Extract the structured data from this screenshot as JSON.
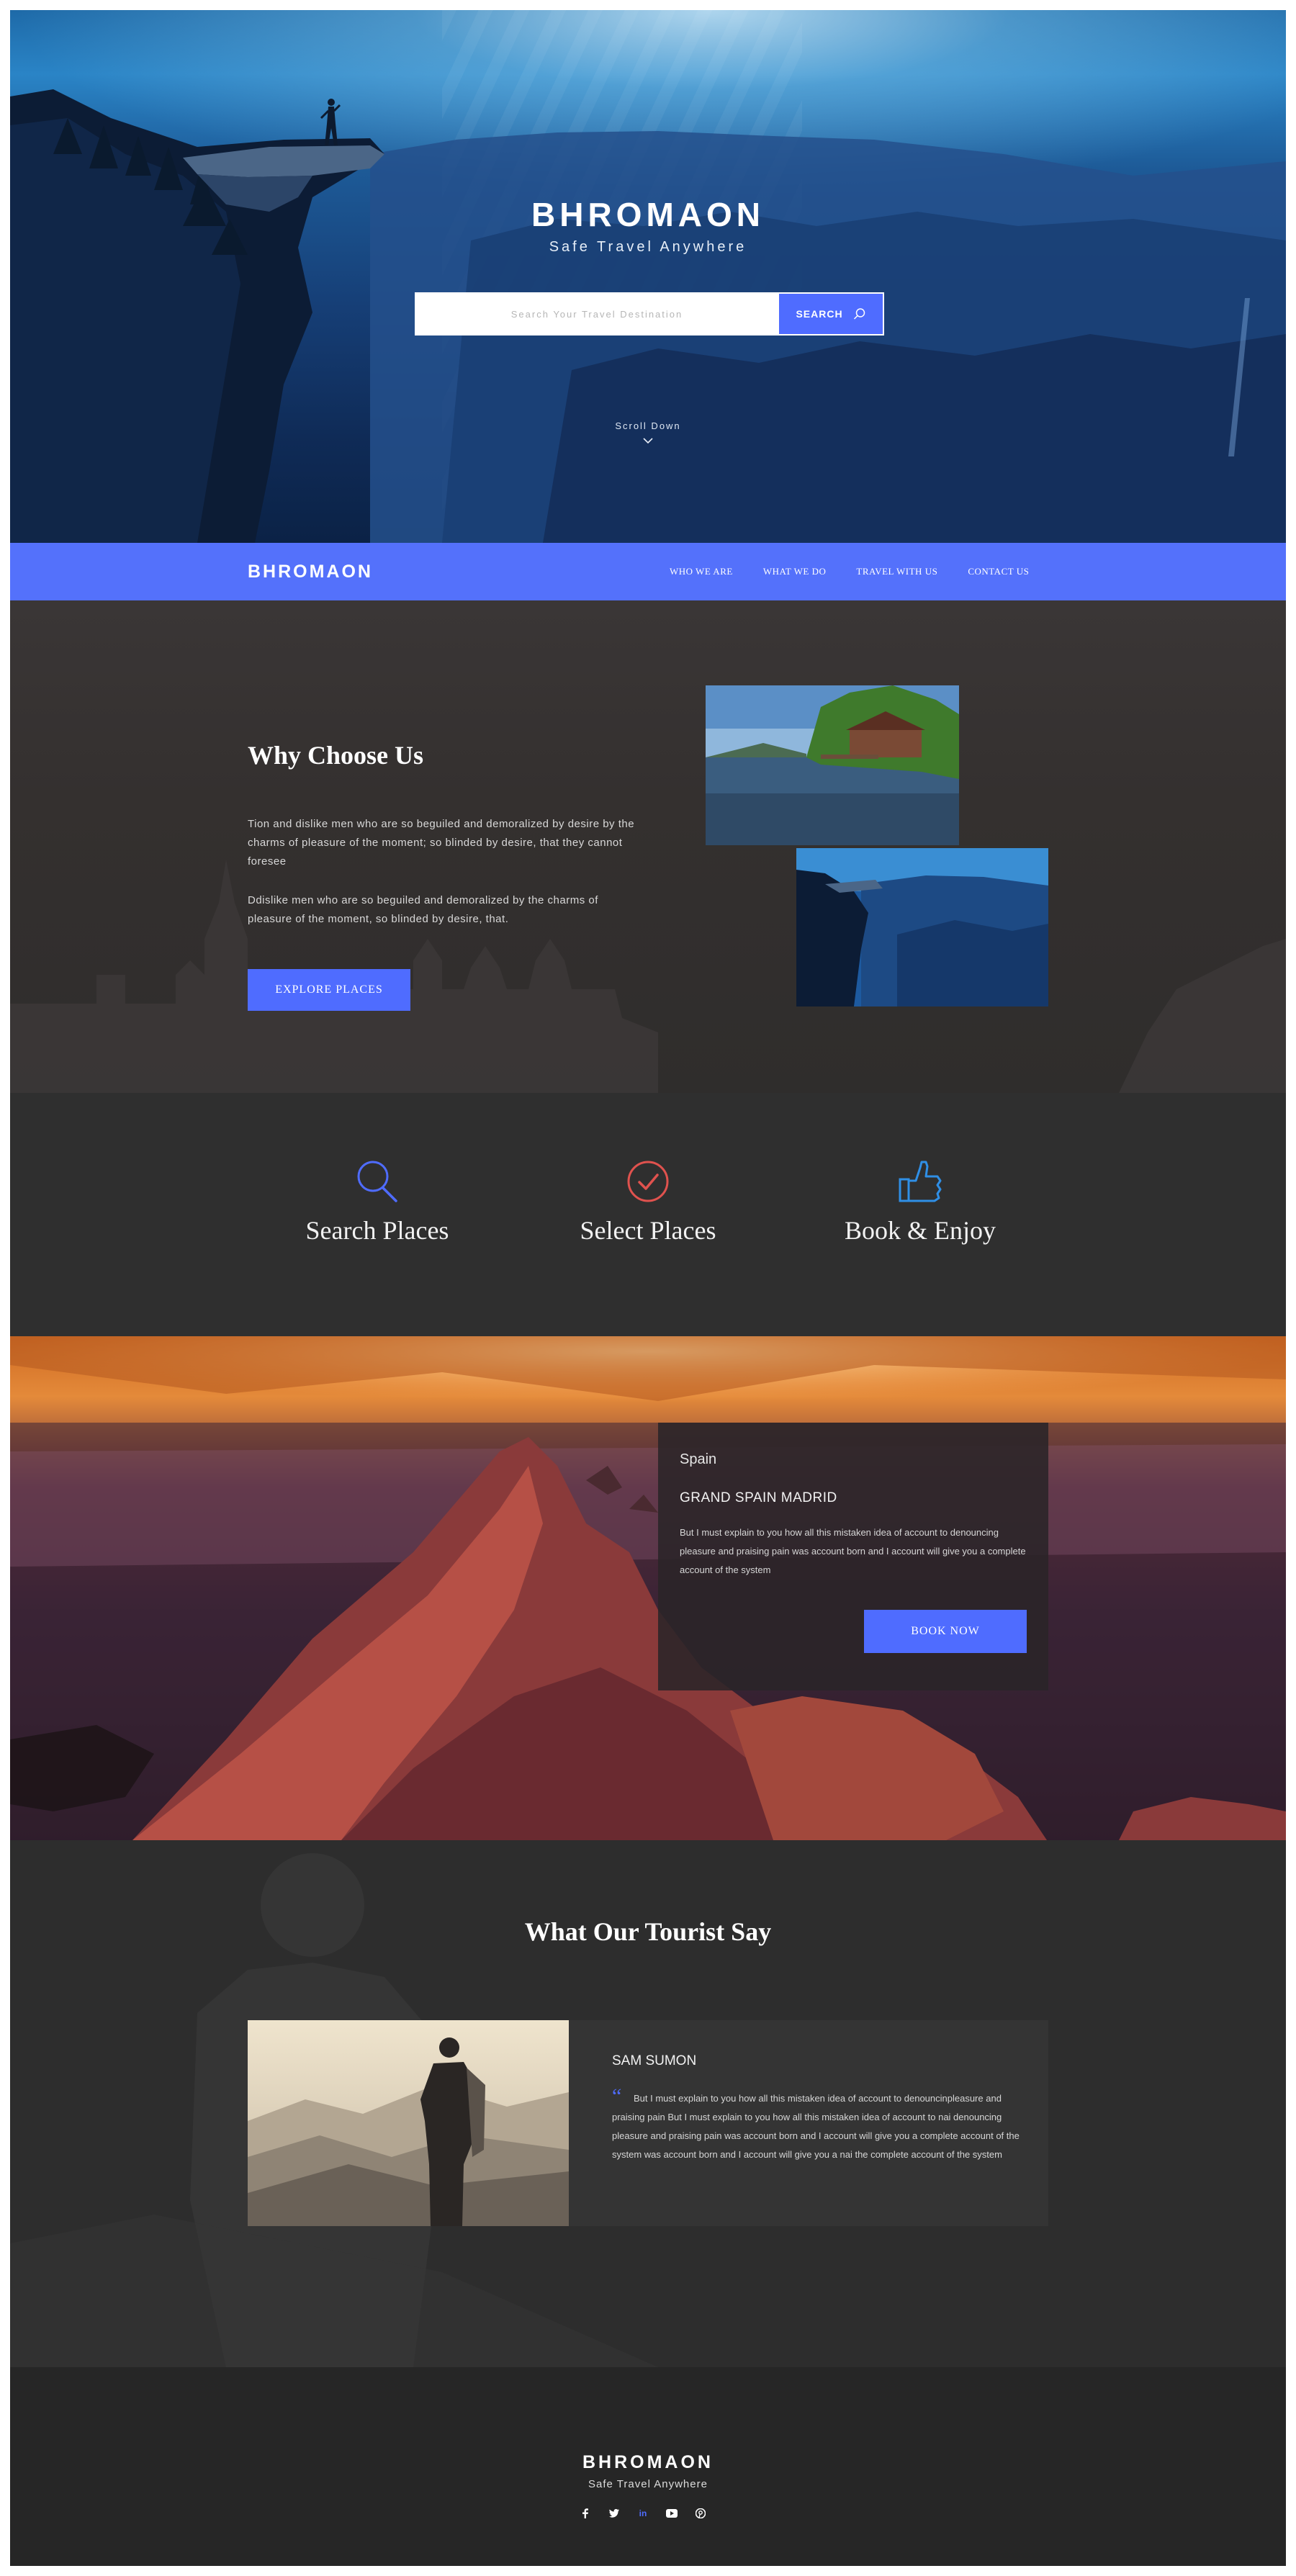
{
  "hero": {
    "brand": "BHROMAON",
    "tagline": "Safe Travel Anywhere",
    "search_placeholder": "Search Your Travel Destination",
    "search_button": "SEARCH",
    "scroll_label": "Scroll Down"
  },
  "nav": {
    "brand": "BHROMAON",
    "links": [
      "WHO WE ARE",
      "WHAT WE DO",
      "TRAVEL WITH US",
      "CONTACT US"
    ]
  },
  "why": {
    "title": "Why Choose Us",
    "paragraph_1": "Tion and dislike men who are so beguiled and demoralized by desire by the charms of pleasure of the moment; so blinded by desire, that they cannot foresee",
    "paragraph_2": "Ddislike men who are so beguiled and demoralized by the charms of pleasure of the moment, so blinded by desire, that.",
    "button": "EXPLORE PLACES"
  },
  "features": [
    {
      "label": "Search Places",
      "icon": "search-icon",
      "color": "#4f6cff"
    },
    {
      "label": "Select Places",
      "icon": "check-circle-icon",
      "color": "#e0524e"
    },
    {
      "label": "Book & Enjoy",
      "icon": "thumbs-up-icon",
      "color": "#2f8fe6"
    }
  ],
  "destination": {
    "country": "Spain",
    "name": "GRAND SPAIN MADRID",
    "description": "But I must explain to you how all this mistaken idea of account to denouncing pleasure and praising pain was account  born and I account will give you a complete account of the system",
    "button": "BOOK NOW"
  },
  "testimonial": {
    "title": "What Our  Tourist Say",
    "name": "SAM SUMON",
    "text": "But I must explain to you how all this mistaken idea of account to denouncinpleasure and praising pain  But I must explain to you how all this mistaken idea of account to nai denouncing pleasure and praising pain was account  born and I account will give you a complete account of the system was account  born and I account will give you a nai the complete account of the system"
  },
  "footer": {
    "brand": "BHROMAON",
    "tagline": "Safe Travel Anywhere",
    "social": [
      "facebook-icon",
      "twitter-icon",
      "linkedin-icon",
      "youtube-icon",
      "pinterest-icon"
    ]
  },
  "colors": {
    "accent": "#4f6cff",
    "nav_bg": "#5471fb",
    "dark_bg": "#2f2f2f",
    "footer_bg": "#262626"
  }
}
